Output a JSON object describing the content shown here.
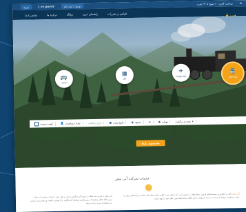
{
  "topbar": {
    "phone": "(۰۲۱)۵۱۴۶۳",
    "login_label": "ورود",
    "account_label": "ورود / ثبت نام",
    "hours": "ساعت کاری ۱۰ صبح تا ۲۲ شب"
  },
  "nav": {
    "items": [
      {
        "label": "تماس با ما"
      },
      {
        "label": "درباره ما"
      },
      {
        "label": "وبلاگ"
      },
      {
        "label": "راهنمای خرید"
      },
      {
        "label": "قوانین و مقررات"
      }
    ]
  },
  "logo": {
    "mark": "سفر",
    "sub": "آنی سفر"
  },
  "services": [
    {
      "label": "بلیط قطار",
      "icon": "train-icon",
      "active": true
    },
    {
      "label": "بلیط هواپیما",
      "icon": "plane-icon",
      "active": false
    },
    {
      "label": "هتل",
      "icon": "hotel-icon",
      "active": false
    },
    {
      "label": "اتوبوس",
      "icon": "bus-icon",
      "active": false
    }
  ],
  "search": {
    "trip_type": "رفت و برگشت",
    "origin": "تهران",
    "destination": "مشهد",
    "date_label": "تاریخ رفت",
    "return_label": "تاریخ برگشت",
    "passengers_label": "تعداد مسافران",
    "exclusive_label": "کوپه دربست"
  },
  "cta_label": "جستجوی بلیط",
  "content": {
    "title": "خدمات شرکت آنی سفر",
    "para_left": "آنی سفر با تجربه چند ساله در حوزه گردشگری و حمل و نقل ریلی، خدمات متنوعی از جمله رزرو بلیط قطار و هواپیما، رزرو هتل و تورهای گردشگری را با بهترین کیفیت و مناسب‌ترین قیمت به مسافران عزیز ارائه می‌دهد.",
    "para_right_highlight": "آنی سفر",
    "para_right": "یکی از کامل‌ترین سیستم‌های فروش بلیط قطار در کشور است که امکان خرید آنلاین بلیط قطار های تمامی شرکت‌های ریلی را برای مسافران فراهم کرده است. شما می‌توانید با چند کلیک ساده بلیط مورد نظر خود را تهیه نمایید."
  },
  "colors": {
    "primary": "#1b4f80",
    "accent": "#f5a31c",
    "page_bg": "#0f4470"
  }
}
